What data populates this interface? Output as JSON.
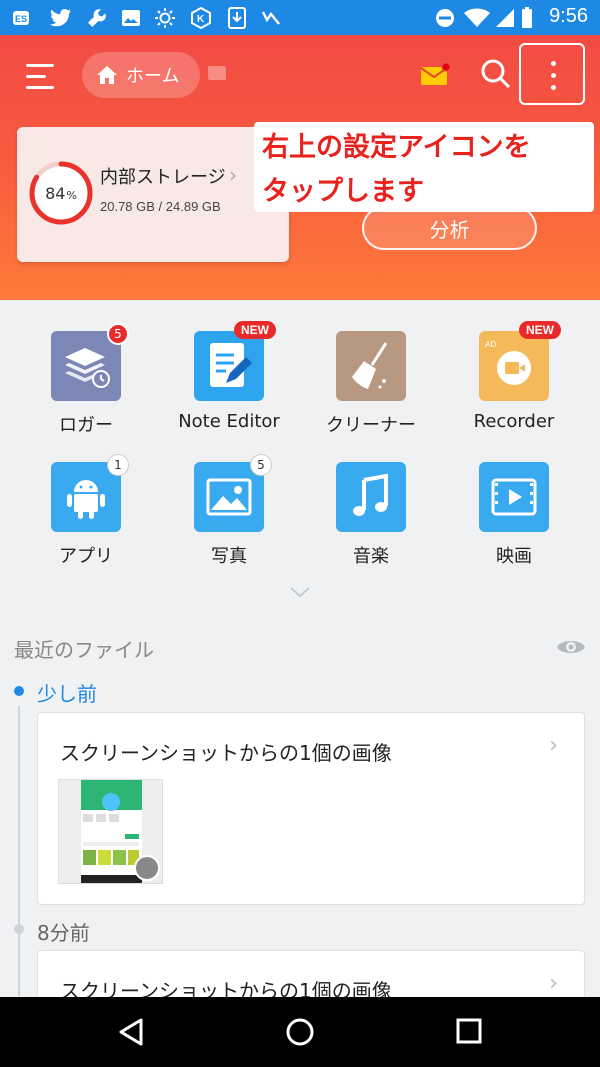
{
  "status_bar": {
    "time": "9:56",
    "left_icons": [
      "es-app-icon",
      "twitter-icon",
      "wrench-icon",
      "image-icon",
      "brightness-icon",
      "k-app-icon",
      "download-icon",
      "tasks-icon"
    ],
    "right_icons": [
      "dnd-icon",
      "wifi-icon",
      "signal-icon",
      "battery-icon"
    ]
  },
  "header": {
    "home_label": "ホーム",
    "annotation_line1": "右上の設定アイコンを",
    "annotation_line2": "タップします",
    "analyze_label": "分析"
  },
  "storage": {
    "percent": "84",
    "percent_unit": "%",
    "percent_value": 84,
    "title": "内部ストレージ",
    "size": "20.78 GB / 24.89 GB"
  },
  "tools": [
    {
      "label": "ロガー",
      "badge": "5",
      "icon": "logger-icon"
    },
    {
      "label": "Note Editor",
      "badge": "NEW",
      "icon": "note-editor-icon"
    },
    {
      "label": "クリーナー",
      "badge": "",
      "icon": "cleaner-icon"
    },
    {
      "label": "Recorder",
      "badge": "NEW",
      "icon": "recorder-icon"
    },
    {
      "label": "アプリ",
      "badge": "1",
      "icon": "android-icon"
    },
    {
      "label": "写真",
      "badge": "5",
      "icon": "photo-icon"
    },
    {
      "label": "音楽",
      "badge": "",
      "icon": "music-icon"
    },
    {
      "label": "映画",
      "badge": "",
      "icon": "movie-icon"
    }
  ],
  "recent": {
    "title": "最近のファイル",
    "groups": [
      {
        "time_label": "少し前",
        "card_title": "スクリーンショットからの1個の画像"
      },
      {
        "time_label": "8分前",
        "card_title": "スクリーンショットからの1個の画像"
      }
    ]
  },
  "colors": {
    "header_top": "#f24a45",
    "header_bottom": "#ff7a3a",
    "accent_blue": "#1e88e5",
    "annotation_red": "#e8221c"
  }
}
